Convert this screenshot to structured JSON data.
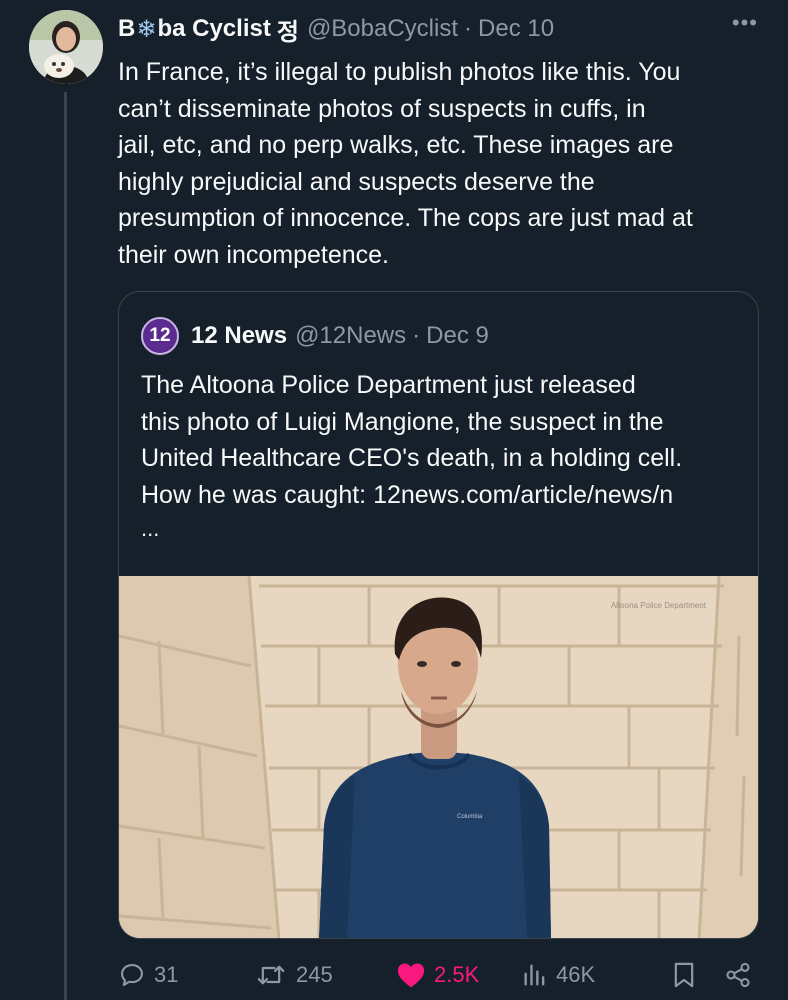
{
  "author": {
    "name_prefix": "B",
    "name_snowflake": "❄",
    "name_suffix": "ba Cyclist",
    "name_hangul": "정",
    "handle": "@BobaCyclist",
    "separator": "·",
    "date": "Dec 10",
    "more_label": "•••"
  },
  "tweet_text": "In France, it’s illegal to publish photos like this. You\ncan’t disseminate photos of suspects in cuffs, in\njail, etc, and no perp walks, etc. These images are\nhighly prejudicial and suspects deserve the\npresumption of innocence. The cops are just mad at\ntheir own incompetence.",
  "quote": {
    "avatar_text": "12",
    "name": "12 News",
    "handle": "@12News",
    "separator": "·",
    "date": "Dec 9",
    "text": "The Altoona Police Department just released\nthis photo of Luigi Mangione, the suspect in the\nUnited Healthcare CEO's death, in a holding cell.\nHow he was caught: 12news.com/article/news/n",
    "ellipsis": "...",
    "photo_watermark": "Altoona Police Department",
    "shirt_logo": "Columbia"
  },
  "actions": {
    "replies": "31",
    "reposts": "245",
    "likes": "2.5K",
    "views": "46K"
  },
  "colors": {
    "background": "#15202b",
    "text": "#f7f9f9",
    "muted": "#8b98a5",
    "border": "#38444d",
    "like": "#f91880"
  }
}
